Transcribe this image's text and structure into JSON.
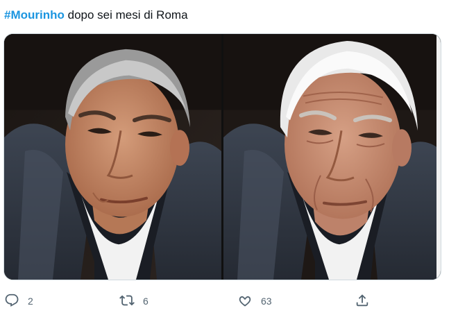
{
  "tweet": {
    "hashtag": "#Mourinho",
    "text": " dopo sei mesi di Roma"
  },
  "media": {
    "left_image": "photo-original-portrait",
    "right_image": "photo-aged-portrait"
  },
  "actions": {
    "reply_count": "2",
    "retweet_count": "6",
    "like_count": "63"
  },
  "colors": {
    "hashtag": "#1b95e0",
    "icon": "#536471"
  }
}
